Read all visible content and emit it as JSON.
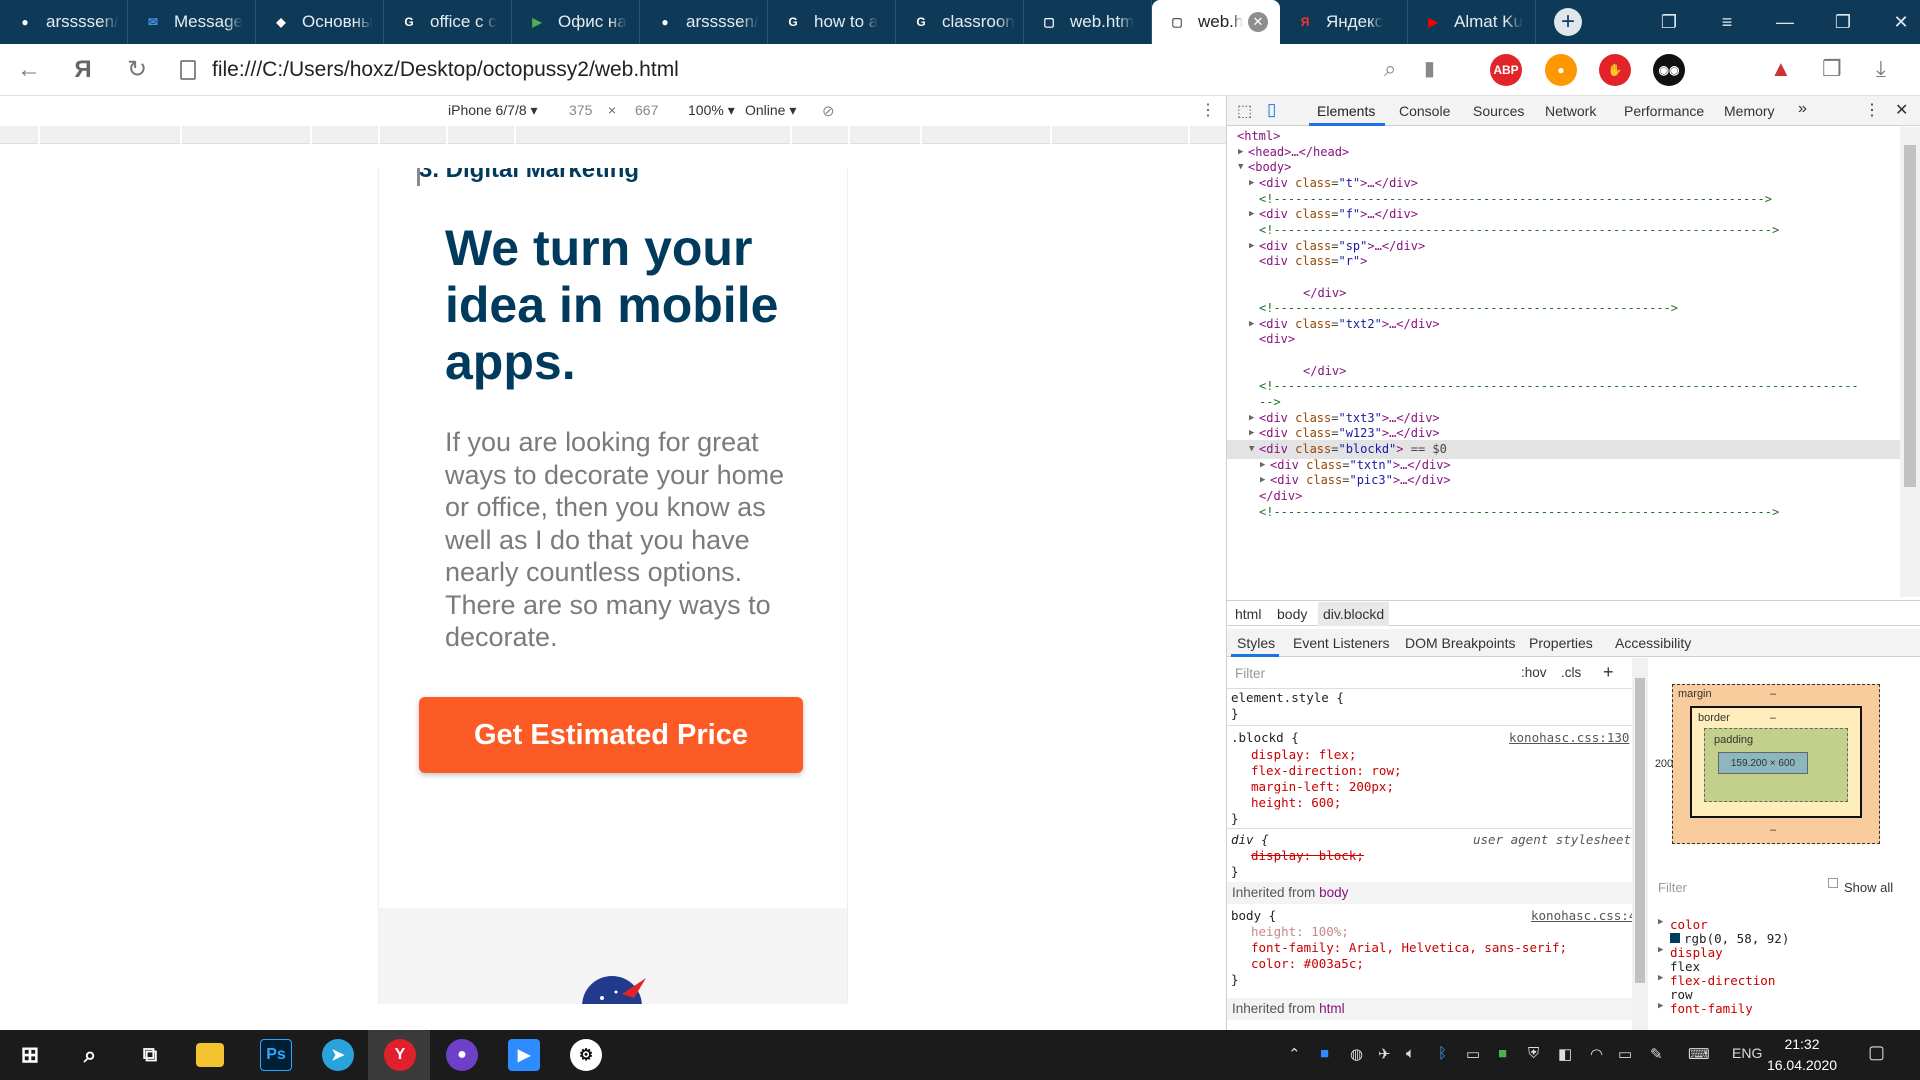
{
  "browser": {
    "tabs": [
      {
        "label": "arssssen/",
        "icon": "github-icon",
        "color": "#ffffff"
      },
      {
        "label": "Message",
        "icon": "message-icon",
        "color": "#4a90e2"
      },
      {
        "label": "Основны",
        "icon": "notion-icon",
        "color": "#ffffff"
      },
      {
        "label": "office c c",
        "icon": "google-icon",
        "color": "#ffffff"
      },
      {
        "label": "Офис на",
        "icon": "play-icon",
        "color": "#4caf50"
      },
      {
        "label": "arssssen/",
        "icon": "github-icon",
        "color": "#ffffff"
      },
      {
        "label": "how to a",
        "icon": "google-icon",
        "color": "#ffffff"
      },
      {
        "label": "classroon",
        "icon": "google-icon",
        "color": "#ffffff"
      },
      {
        "label": "web.htm",
        "icon": "file-icon",
        "color": "#ffffff"
      },
      {
        "label": "web.h",
        "icon": "file-icon",
        "color": "#555555",
        "active": true
      },
      {
        "label": "Яндекс",
        "icon": "yandex-icon",
        "color": "#f33"
      },
      {
        "label": "Almat Ku",
        "icon": "youtube-icon",
        "color": "#f00"
      }
    ],
    "url": "file:///C:/Users/hoxz/Desktop/octopussy2/web.html",
    "extensions": [
      {
        "name": "adblock-icon",
        "text": "ABP",
        "color": "#e2242a"
      },
      {
        "name": "ok-icon",
        "text": "",
        "color": "#ff9800"
      },
      {
        "name": "stop-hand-icon",
        "text": "",
        "color": "#e2242a"
      },
      {
        "name": "mask-icon",
        "text": "",
        "color": "#111111"
      }
    ]
  },
  "device_toolbar": {
    "device": "iPhone 6/7/8",
    "width": "375",
    "times": "×",
    "height": "667",
    "zoom": "100%",
    "network": "Online"
  },
  "page": {
    "top_cut_text": "3. Digital Marketing",
    "hero_title": "We turn your idea in mobile apps.",
    "hero_text": "If you are looking for great ways to decorate your home or office, then you know as well as I do that you have nearly countless options. There are so many ways to decorate.",
    "cta_label": "Get Estimated Price",
    "brand_color": "#003a5c",
    "cta_color": "#fd5b25"
  },
  "devtools": {
    "tabs": [
      "Elements",
      "Console",
      "Sources",
      "Network",
      "Performance",
      "Memory"
    ],
    "more": "»",
    "dom_lines": [
      {
        "indent": 0,
        "arrow": "",
        "html": "<html>"
      },
      {
        "indent": 1,
        "arrow": "▶",
        "html": "<head>…</head>"
      },
      {
        "indent": 1,
        "arrow": "▼",
        "html": "<body>"
      },
      {
        "indent": 2,
        "arrow": "▶",
        "html": "<div class=\"t\">…</div>"
      },
      {
        "indent": 2,
        "arrow": "",
        "html": "<!-------------------------------------------------------------------->",
        "comment": true
      },
      {
        "indent": 2,
        "arrow": "▶",
        "html": "<div class=\"f\">…</div>"
      },
      {
        "indent": 2,
        "arrow": "",
        "html": "<!--------------------------------------------------------------------->",
        "comment": true
      },
      {
        "indent": 2,
        "arrow": "▶",
        "html": "<div class=\"sp\">…</div>"
      },
      {
        "indent": 2,
        "arrow": "",
        "html": "<div class=\"r\">"
      },
      {
        "indent": 2,
        "arrow": "",
        "html": ""
      },
      {
        "indent": 6,
        "arrow": "",
        "html": "</div>"
      },
      {
        "indent": 2,
        "arrow": "",
        "html": "<!------------------------------------------------------->",
        "comment": true
      },
      {
        "indent": 2,
        "arrow": "▶",
        "html": "<div class=\"txt2\">…</div>"
      },
      {
        "indent": 2,
        "arrow": "",
        "html": "<div>"
      },
      {
        "indent": 2,
        "arrow": "",
        "html": ""
      },
      {
        "indent": 6,
        "arrow": "",
        "html": "</div>"
      },
      {
        "indent": 2,
        "arrow": "",
        "html": "<!---------------------------------------------------------------------------------",
        "comment": true
      },
      {
        "indent": 2,
        "arrow": "",
        "html": "-->",
        "comment": true
      },
      {
        "indent": 2,
        "arrow": "▶",
        "html": "<div class=\"txt3\">…</div>"
      },
      {
        "indent": 2,
        "arrow": "▶",
        "html": "<div class=\"w123\">…</div>"
      },
      {
        "indent": 2,
        "arrow": "▼",
        "html": "<div class=\"blockd\"> == $0",
        "selected": true
      },
      {
        "indent": 3,
        "arrow": "▶",
        "html": "<div class=\"txtn\">…</div>"
      },
      {
        "indent": 3,
        "arrow": "▶",
        "html": "<div class=\"pic3\">…</div>"
      },
      {
        "indent": 2,
        "arrow": "",
        "html": "</div>"
      },
      {
        "indent": 2,
        "arrow": "",
        "html": "<!--------------------------------------------------------------------->",
        "comment": true
      }
    ],
    "breadcrumbs": [
      "html",
      "body",
      "div.blockd"
    ],
    "pane_tabs": [
      "Styles",
      "Event Listeners",
      "DOM Breakpoints",
      "Properties",
      "Accessibility"
    ],
    "styles": {
      "filter_placeholder": "Filter",
      "hov": ":hov",
      "cls": ".cls",
      "plus": "+",
      "element_style": "element.style {",
      "close": "}",
      "blockd_selector": ".blockd {",
      "blockd_source": "konohasc.css:130",
      "blockd_props": [
        "display: flex;",
        "flex-direction: row;",
        "margin-left: 200px;",
        "height: 600;"
      ],
      "div_selector": "div {",
      "div_source": "user agent stylesheet",
      "div_prop": "display: block;",
      "inherited_body": "Inherited from",
      "inherited_body_el": "body",
      "body_selector": "body {",
      "body_source": "konohasc.css:4",
      "body_props": [
        "height: 100%;",
        "font-family: Arial, Helvetica, sans-serif;",
        "color: #003a5c;"
      ],
      "inherited_html": "Inherited from",
      "inherited_html_el": "html"
    },
    "box_model": {
      "margin": "margin",
      "border": "border",
      "padding": "padding",
      "dash": "–",
      "left_margin": "200",
      "content": "159.200 × 600"
    },
    "computed": {
      "filter_placeholder": "Filter",
      "show_all": "Show all",
      "props": [
        {
          "name": "color",
          "value": "rgb(0, 58, 92)",
          "swatch": "#003a5c"
        },
        {
          "name": "display",
          "value": "flex"
        },
        {
          "name": "flex-direction",
          "value": "row"
        },
        {
          "name": "font-family",
          "value": ""
        }
      ]
    }
  },
  "taskbar": {
    "apps": [
      "explorer",
      "photoshop",
      "telegram",
      "yandex",
      "github-desktop",
      "zoom",
      "steam"
    ],
    "lang": "ENG",
    "time": "21:32",
    "date": "16.04.2020"
  }
}
